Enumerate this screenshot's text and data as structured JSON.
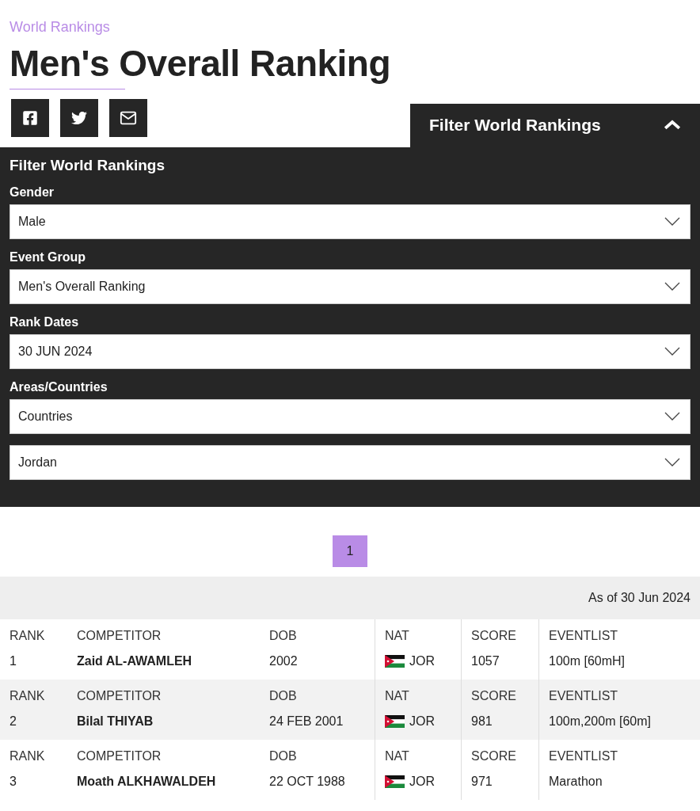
{
  "breadcrumb": "World Rankings",
  "title": "Men's Overall Ranking",
  "share_buttons": [
    {
      "kind": "facebook"
    },
    {
      "kind": "twitter"
    },
    {
      "kind": "email"
    }
  ],
  "filter": {
    "toggle_label": "Filter World Rankings",
    "expanded": true,
    "heading": "Filter World Rankings",
    "fields": [
      {
        "label": "Gender",
        "value": "Male"
      },
      {
        "label": "Event Group",
        "value": "Men's Overall Ranking"
      },
      {
        "label": "Rank Dates",
        "value": "30 JUN 2024"
      },
      {
        "label": "Areas/Countries",
        "value": "Countries"
      },
      {
        "value": "Jordan"
      }
    ]
  },
  "pagination": [
    {
      "label": "1",
      "selected": true
    }
  ],
  "as_of": "As of 30 Jun 2024",
  "rows": [
    {
      "cells": [
        {
          "header": "RANK",
          "value": "1"
        },
        {
          "header": "COMPETITOR",
          "value": "Zaid AL-AWAMLEH",
          "kind": "name"
        },
        {
          "header": "DOB",
          "value": "2002"
        },
        {
          "header": "NAT",
          "value": "JOR",
          "kind": "flag"
        },
        {
          "header": "SCORE",
          "value": "1057"
        },
        {
          "header": "EVENTLIST",
          "value": "100m [60mH]"
        }
      ]
    },
    {
      "cells": [
        {
          "header": "RANK",
          "value": "2"
        },
        {
          "header": "COMPETITOR",
          "value": "Bilal THIYAB",
          "kind": "name"
        },
        {
          "header": "DOB",
          "value": "24 FEB 2001"
        },
        {
          "header": "NAT",
          "value": "JOR",
          "kind": "flag"
        },
        {
          "header": "SCORE",
          "value": "981"
        },
        {
          "header": "EVENTLIST",
          "value": "100m,200m [60m]"
        }
      ]
    },
    {
      "cells": [
        {
          "header": "RANK",
          "value": "3"
        },
        {
          "header": "COMPETITOR",
          "value": "Moath ALKHAWALDEH",
          "kind": "name"
        },
        {
          "header": "DOB",
          "value": "22 OCT 1988"
        },
        {
          "header": "NAT",
          "value": "JOR",
          "kind": "flag"
        },
        {
          "header": "SCORE",
          "value": "971"
        },
        {
          "header": "EVENTLIST",
          "value": "Marathon"
        }
      ]
    }
  ]
}
